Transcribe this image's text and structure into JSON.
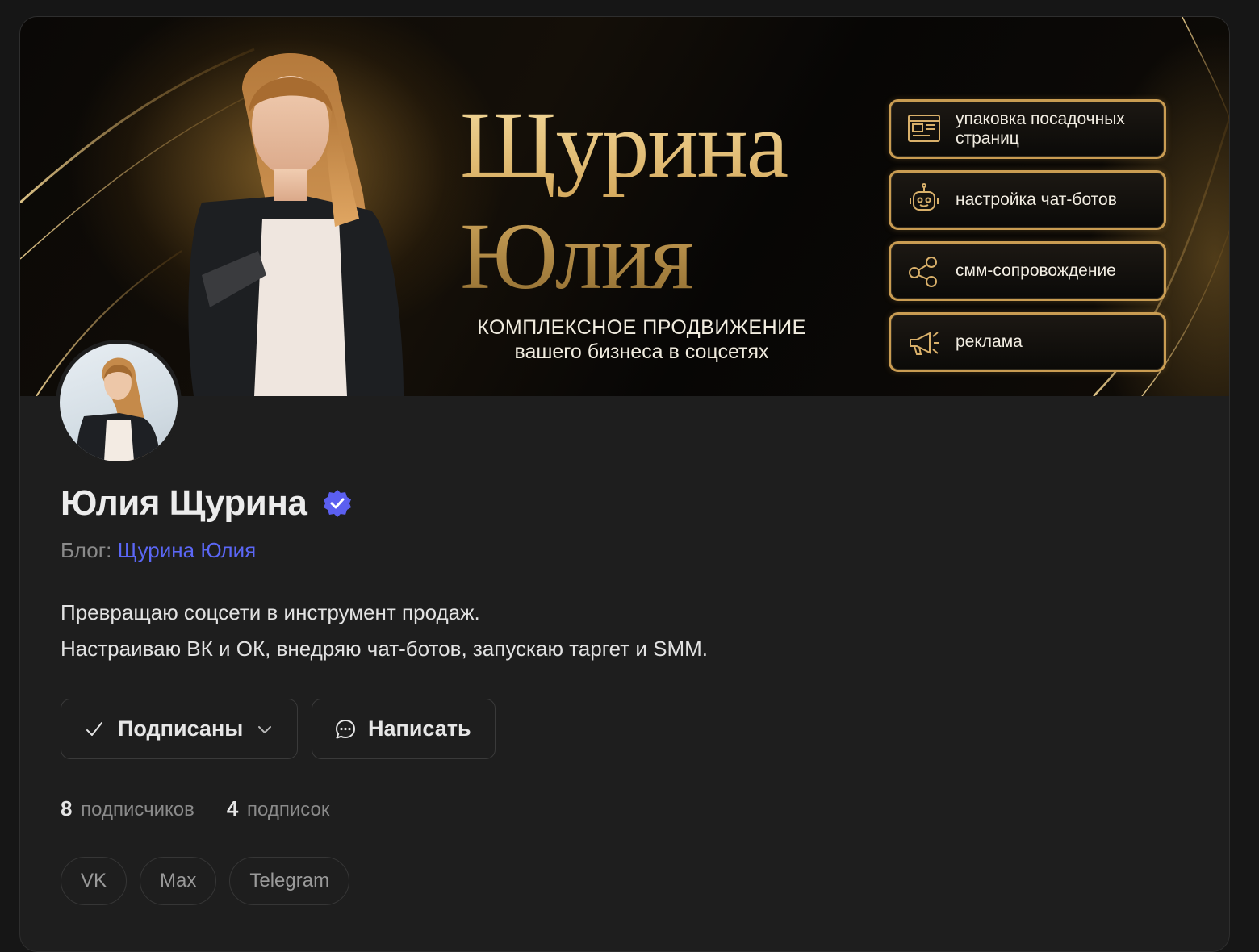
{
  "cover": {
    "title_line1": "Щурина",
    "title_line2": "Юлия",
    "subtitle_line1": "КОМПЛЕКСНОЕ ПРОДВИЖЕНИЕ",
    "subtitle_line2": "вашего бизнеса в соцсетях",
    "services": [
      {
        "label": "упаковка посадочных страниц",
        "icon": "landing-page-icon"
      },
      {
        "label": "настройка чат-ботов",
        "icon": "robot-icon"
      },
      {
        "label": "смм-сопровождение",
        "icon": "people-network-icon"
      },
      {
        "label": "реклама",
        "icon": "megaphone-icon"
      }
    ],
    "accent_gold": "#c99c52"
  },
  "profile": {
    "name": "Юлия Щурина",
    "blog_prefix": "Блог:",
    "blog_name": "Щурина Юлия",
    "bio_line1": "Превращаю соцсети в инструмент продаж.",
    "bio_line2": "Настраиваю ВК и ОК, внедряю чат-ботов, запускаю таргет и SMM.",
    "verified_color": "#5b5ff0",
    "link_color": "#5b67f5"
  },
  "actions": {
    "subscribed_label": "Подписаны",
    "message_label": "Написать"
  },
  "stats": {
    "followers_count": "8",
    "followers_label": "подписчиков",
    "following_count": "4",
    "following_label": "подписок"
  },
  "social_links": [
    "VK",
    "Max",
    "Telegram"
  ]
}
